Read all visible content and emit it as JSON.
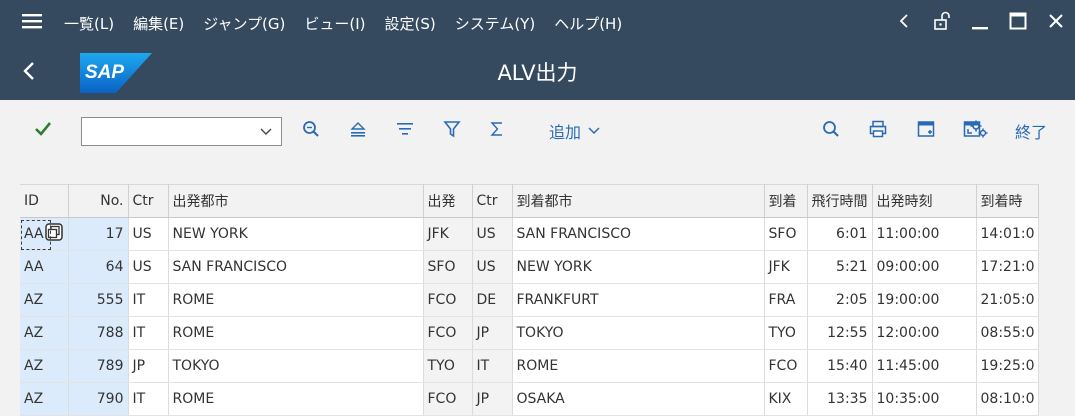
{
  "colors": {
    "shell": "#354a5f",
    "accent": "#2a6ab5",
    "key_cell": "#dcebfb",
    "ok_check": "#2b7d2b"
  },
  "menu": {
    "items": [
      "一覧(L)",
      "編集(E)",
      "ジャンプ(G)",
      "ビュー(I)",
      "設定(S)",
      "システム(Y)",
      "ヘルプ(H)"
    ]
  },
  "window": {
    "icons": [
      "chevron-left-icon",
      "unlock-icon",
      "minimize-icon",
      "maximize-icon",
      "close-icon"
    ]
  },
  "title": {
    "logo": "SAP",
    "text": "ALV出力"
  },
  "toolbar": {
    "command_value": "",
    "icons": [
      "checkmark-icon",
      "find-icon",
      "sort-ascending-icon",
      "sort-descending-icon",
      "filter-icon",
      "sum-icon",
      "search-icon",
      "print-icon",
      "export-icon",
      "layout-icon",
      "settings-icon"
    ],
    "add_label": "追加",
    "exit_label": "終了"
  },
  "grid": {
    "columns": [
      "ID",
      "No.",
      "Ctr",
      "出発都市",
      "出発",
      "Ctr",
      "到着都市",
      "到着",
      "飛行時間",
      "出発時刻",
      "到着時"
    ],
    "rows": [
      [
        "AA",
        "17",
        "US",
        "NEW YORK",
        "JFK",
        "US",
        "SAN FRANCISCO",
        "SFO",
        "6:01",
        "11:00:00",
        "14:01:0"
      ],
      [
        "AA",
        "64",
        "US",
        "SAN FRANCISCO",
        "SFO",
        "US",
        "NEW YORK",
        "JFK",
        "5:21",
        "09:00:00",
        "17:21:0"
      ],
      [
        "AZ",
        "555",
        "IT",
        "ROME",
        "FCO",
        "DE",
        "FRANKFURT",
        "FRA",
        "2:05",
        "19:00:00",
        "21:05:0"
      ],
      [
        "AZ",
        "788",
        "IT",
        "ROME",
        "FCO",
        "JP",
        "TOKYO",
        "TYO",
        "12:55",
        "12:00:00",
        "08:55:0"
      ],
      [
        "AZ",
        "789",
        "JP",
        "TOKYO",
        "TYO",
        "IT",
        "ROME",
        "FCO",
        "15:40",
        "11:45:00",
        "19:25:0"
      ],
      [
        "AZ",
        "790",
        "IT",
        "ROME",
        "FCO",
        "JP",
        "OSAKA",
        "KIX",
        "13:35",
        "10:35:00",
        "08:10:0"
      ]
    ]
  }
}
